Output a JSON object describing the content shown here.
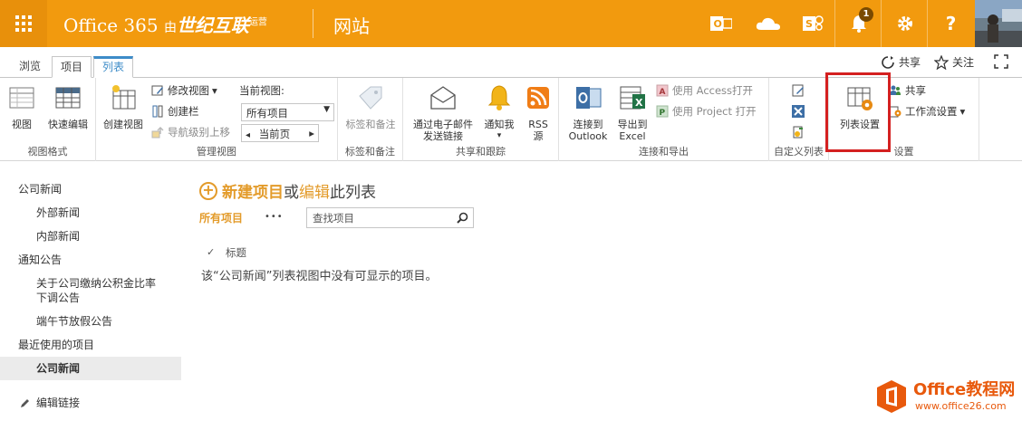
{
  "suitebar": {
    "brand_main": "Office 365",
    "brand_by": "由",
    "brand_partner": "世纪互联",
    "brand_op": "运营",
    "site_link": "网站",
    "notification_count": "1",
    "help": "?"
  },
  "tabs": {
    "browse": "浏览",
    "items": "项目",
    "list": "列表",
    "share": "共享",
    "follow": "关注"
  },
  "ribbon": {
    "view": "视图",
    "quick_edit": "快速编辑",
    "group_view_format": "视图格式",
    "create_view": "创建视图",
    "modify_view": "修改视图",
    "create_column": "创建栏",
    "navigate_up": "导航级别上移",
    "current_view_label": "当前视图:",
    "current_view_value": "所有项目",
    "current_page": "当前页",
    "group_manage_views": "管理视图",
    "tags_notes": "标签和备注",
    "group_tags": "标签和备注",
    "email_link_1": "通过电子邮件",
    "email_link_2": "发送链接",
    "alert_me": "通知我",
    "rss_1": "RSS",
    "rss_2": "源",
    "group_share_track": "共享和跟踪",
    "connect_outlook_1": "连接到",
    "connect_outlook_2": "Outlook",
    "export_excel_1": "导出到",
    "export_excel_2": "Excel",
    "open_access": "使用 Access打开",
    "open_project": "使用 Project 打开",
    "group_connect_export": "连接和导出",
    "group_customize": "自定义列表",
    "list_settings": "列表设置",
    "share": "共享",
    "workflow_settings": "工作流设置",
    "group_settings": "设置"
  },
  "leftnav": {
    "company_news": "公司新闻",
    "external_news": "外部新闻",
    "internal_news": "内部新闻",
    "notices": "通知公告",
    "notice_1": "关于公司缴纳公积金比率下调公告",
    "notice_2": "端午节放假公告",
    "recent": "最近使用的项目",
    "recent_1": "公司新闻",
    "edit_links": "编辑链接"
  },
  "main": {
    "new_item": "新建项目",
    "or": "或",
    "edit": "编辑",
    "this_list": "此列表",
    "all_items": "所有项目",
    "more": "•••",
    "search_placeholder": "查找项目",
    "column_title": "标题",
    "empty_message": "该“公司新闻”列表视图中没有可显示的项目。"
  },
  "watermark": {
    "name": "Office教程网",
    "url": "www.office26.com"
  },
  "colors": {
    "suitebar": "#f29a0e",
    "accent_orange": "#e39b2a",
    "tab_blue": "#3d8cc8",
    "highlight_red": "#d42020"
  }
}
